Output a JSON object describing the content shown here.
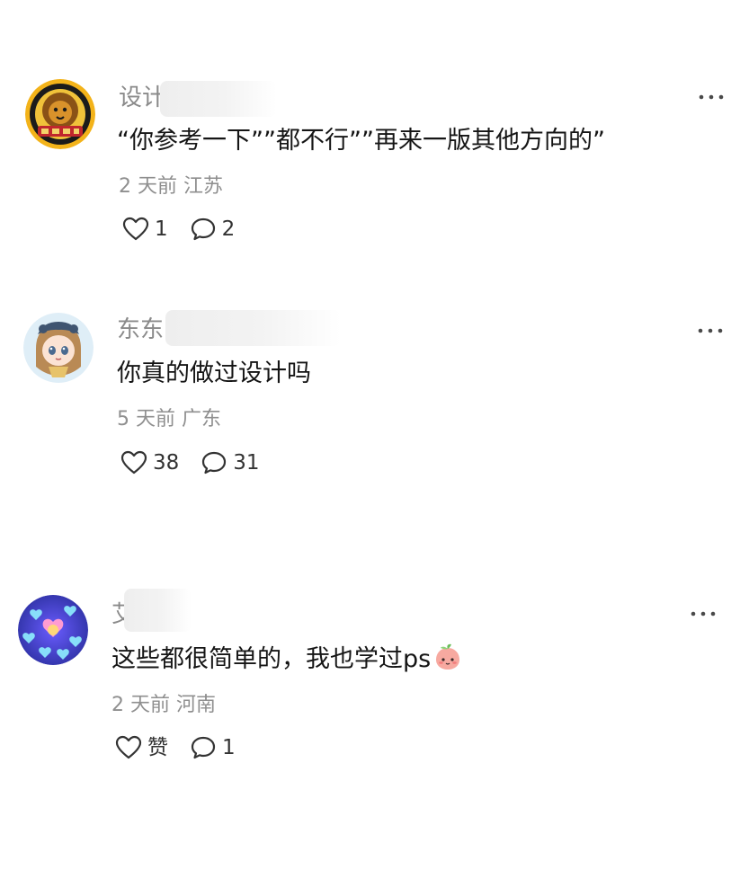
{
  "comments": [
    {
      "username": "设计",
      "content": "“你参考一下””都不行””再来一版其他方向的”",
      "time": "2 天前",
      "location": "江苏",
      "likes": "1",
      "replies": "2",
      "avatar_icon": "lion-badge-avatar"
    },
    {
      "username": "东东",
      "content": "你真的做过设计吗",
      "time": "5 天前",
      "location": "广东",
      "likes": "38",
      "replies": "31",
      "avatar_icon": "anime-girl-avatar"
    },
    {
      "username": "艾",
      "content": "这些都很简单的，我也学过ps",
      "time": "2 天前",
      "location": "河南",
      "likes": "赞",
      "replies": "1",
      "avatar_icon": "hearts-avatar"
    }
  ],
  "icons": {
    "like": "heart-icon",
    "reply": "comment-bubble-icon",
    "more": "more-dots-icon",
    "emoji": "peach-face-emoji"
  },
  "colors": {
    "username": "#8a8a8a",
    "content": "#151515",
    "meta": "#8f8f8f"
  }
}
